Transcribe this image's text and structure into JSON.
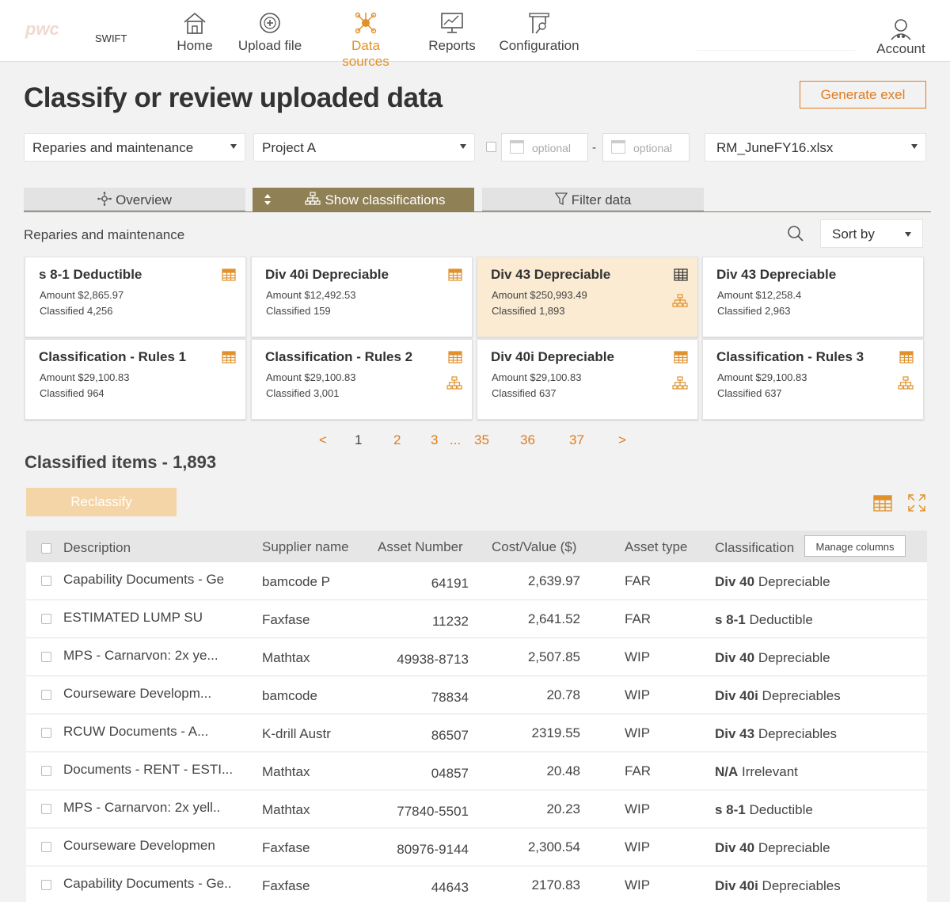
{
  "nav": {
    "logo": "pwc",
    "app_name": "SWIFT",
    "items": [
      {
        "label": "Home",
        "icon": "home-icon"
      },
      {
        "label": "Upload file",
        "icon": "upload-icon"
      },
      {
        "label": "Data sources",
        "icon": "data-sources-icon",
        "active": true
      },
      {
        "label": "Reports",
        "icon": "reports-icon"
      },
      {
        "label": "Configuration",
        "icon": "configuration-icon"
      }
    ],
    "account": "Account"
  },
  "page": {
    "title": "Classify or review uploaded data",
    "generate_button": "Generate exel"
  },
  "filters": {
    "category": "Reparies and maintenance",
    "project": "Project A",
    "date_from_placeholder": "optional",
    "date_sep": "-",
    "date_to_placeholder": "optional",
    "file": "RM_JuneFY16.xlsx"
  },
  "tabs": [
    "Overview",
    "Show classifications",
    "Filter data"
  ],
  "section": {
    "title": "Reparies and maintenance",
    "sort_label": "Sort by"
  },
  "cards": [
    {
      "title": "s 8-1 Deductible",
      "amount": "Amount $2,865.97",
      "classified": "Classified 4,256",
      "icons": [
        "table"
      ]
    },
    {
      "title": "Div 40i Depreciable",
      "amount": "Amount $12,492.53",
      "classified": "Classified 159",
      "icons": [
        "table"
      ]
    },
    {
      "title": "Div 43  Depreciable",
      "amount": "Amount $250,993.49",
      "classified": "Classified 1,893",
      "icons": [
        "table",
        "hierarchy"
      ],
      "selected": true
    },
    {
      "title": "Div 43  Depreciable",
      "amount": "Amount $12,258.4",
      "classified": "Classified 2,963",
      "icons": []
    },
    {
      "title": "Classification - Rules 1",
      "amount": "Amount $29,100.83",
      "classified": "Classified 964",
      "icons": [
        "table"
      ]
    },
    {
      "title": "Classification - Rules 2",
      "amount": "Amount $29,100.83",
      "classified": "Classified 3,001",
      "icons": [
        "table",
        "hierarchy"
      ]
    },
    {
      "title": "Div 40i Depreciable",
      "amount": "Amount $29,100.83",
      "classified": "Classified 637",
      "icons": [
        "table",
        "hierarchy"
      ]
    },
    {
      "title": "Classification - Rules 3",
      "amount": "Amount $29,100.83",
      "classified": "Classified 637",
      "icons": [
        "table",
        "hierarchy"
      ]
    }
  ],
  "pagination": {
    "prev": "<",
    "pages": [
      "1",
      "2",
      "3",
      "...",
      "35",
      "36",
      "37"
    ],
    "current": "1",
    "next": ">"
  },
  "classified": {
    "title": "Classified items - 1,893",
    "reclassify_button": "Reclassify",
    "tooltip": "Manage columns"
  },
  "table": {
    "headers": [
      "Description",
      "Supplier name",
      "Asset Number",
      "Cost/Value ($)",
      "Asset type",
      "Classification"
    ],
    "rows": [
      {
        "desc": "Capability Documents - Ge",
        "supplier": "bamcode P",
        "asset": "64191",
        "cost": "2,639.97",
        "type": "FAR",
        "class_code": "Div 40",
        "class_name": "Depreciable"
      },
      {
        "desc": "ESTIMATED LUMP SU",
        "supplier": "Faxfase",
        "asset": "11232",
        "cost": "2,641.52",
        "type": "FAR",
        "class_code": "s 8-1",
        "class_name": "Deductible"
      },
      {
        "desc": "MPS - Carnarvon: 2x ye...",
        "supplier": "Mathtax",
        "asset": "49938-8713",
        "cost": "2,507.85",
        "type": "WIP",
        "class_code": "Div 40",
        "class_name": "Depreciable"
      },
      {
        "desc": "Courseware Developm...",
        "supplier": "bamcode",
        "asset": "78834",
        "cost": "20.78",
        "type": "WIP",
        "class_code": "Div 40i",
        "class_name": "Depreciables"
      },
      {
        "desc": "RCUW Documents - A...",
        "supplier": "K-drill Austr",
        "asset": "86507",
        "cost": "2319.55",
        "type": "WIP",
        "class_code": "Div 43",
        "class_name": " Depreciables"
      },
      {
        "desc": "Documents - RENT -  ESTI...",
        "supplier": "Mathtax",
        "asset": "04857",
        "cost": "20.48",
        "type": "FAR",
        "class_code": "N/A",
        "class_name": "Irrelevant"
      },
      {
        "desc": "MPS - Carnarvon: 2x yell..",
        "supplier": "Mathtax",
        "asset": "77840-5501",
        "cost": "20.23",
        "type": "WIP",
        "class_code": "s 8-1",
        "class_name": "Deductible"
      },
      {
        "desc": "Courseware Developmen",
        "supplier": "Faxfase",
        "asset": "80976-9144",
        "cost": "2,300.54",
        "type": "WIP",
        "class_code": "Div 40",
        "class_name": "Depreciable"
      },
      {
        "desc": "Capability Documents - Ge..",
        "supplier": "Faxfase",
        "asset": "44643",
        "cost": "2170.83",
        "type": "WIP",
        "class_code": "Div 40i",
        "class_name": "Depreciables"
      }
    ]
  },
  "colors": {
    "accent": "#e07b1f",
    "active_tab": "#8f8055",
    "selected_card": "#faebd2",
    "reclassify_bg": "#f4d5a8"
  }
}
